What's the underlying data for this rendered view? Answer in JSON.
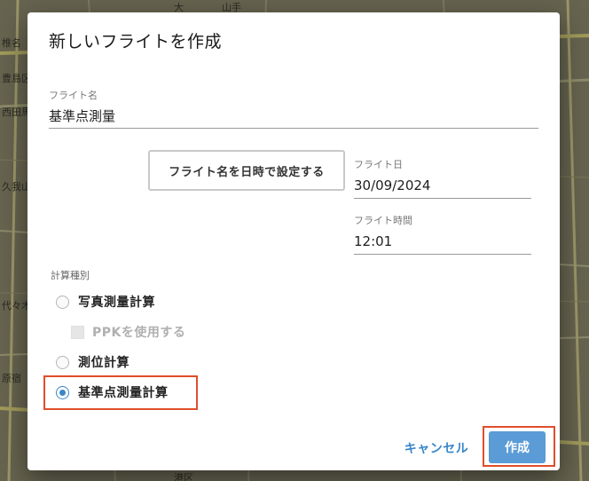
{
  "background_map": {
    "labels": [
      "椎名",
      "豊島区",
      "西田馬",
      "久我山",
      "代々木",
      "原宿",
      "港区",
      "山手",
      "大"
    ]
  },
  "dialog": {
    "title": "新しいフライトを作成",
    "flight_name": {
      "label": "フライト名",
      "value": "基準点測量"
    },
    "set_by_datetime_button": "フライト名を日時で設定する",
    "flight_date": {
      "label": "フライト日",
      "value": "30/09/2024"
    },
    "flight_time": {
      "label": "フライト時間",
      "value": "12:01"
    },
    "calculation_type": {
      "label": "計算種別",
      "options": [
        {
          "label": "写真測量計算",
          "selected": false
        },
        {
          "label": "測位計算",
          "selected": false
        },
        {
          "label": "基準点測量計算",
          "selected": true
        }
      ],
      "ppk_checkbox": {
        "label": "PPKを使用する",
        "checked": false,
        "disabled": true
      }
    },
    "cancel_label": "キャンセル",
    "create_label": "作成"
  },
  "colors": {
    "accent": "#3a86c8",
    "primary_button": "#5b9bd6",
    "highlight": "#e04e2c"
  }
}
